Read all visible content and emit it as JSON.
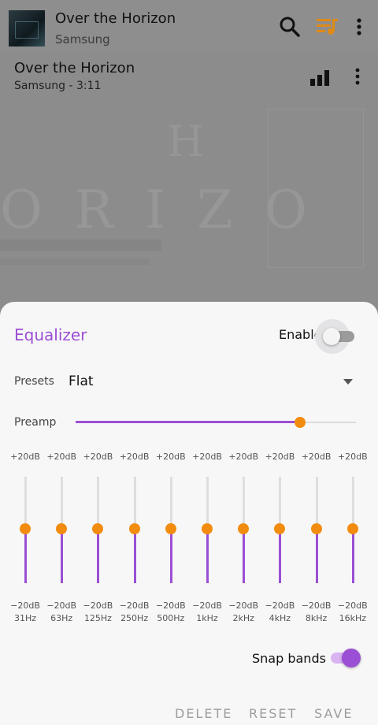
{
  "mini_player": {
    "title": "Over the Horizon",
    "artist": "Samsung"
  },
  "now_playing": {
    "title": "Over the Horizon",
    "subtitle": "Samsung  -  3:11",
    "art_letters": "ORIZO",
    "art_h": "H"
  },
  "icons": {
    "search": "search-icon",
    "queue": "queue-music-icon",
    "more": "more-vertical-icon",
    "equalizer_bars": "equalizer-bars-icon",
    "dropdown": "chevron-down-icon"
  },
  "equalizer": {
    "title": "Equalizer",
    "enable_label": "Enable",
    "enabled": false,
    "presets_label": "Presets",
    "preset_value": "Flat",
    "preamp_label": "Preamp",
    "preamp_level": 0.8,
    "bands": [
      {
        "freq": "31Hz",
        "max": "+20dB",
        "min": "−20dB",
        "gain_db": 0
      },
      {
        "freq": "63Hz",
        "max": "+20dB",
        "min": "−20dB",
        "gain_db": 0
      },
      {
        "freq": "125Hz",
        "max": "+20dB",
        "min": "−20dB",
        "gain_db": 0
      },
      {
        "freq": "250Hz",
        "max": "+20dB",
        "min": "−20dB",
        "gain_db": 0
      },
      {
        "freq": "500Hz",
        "max": "+20dB",
        "min": "−20dB",
        "gain_db": 0
      },
      {
        "freq": "1kHz",
        "max": "+20dB",
        "min": "−20dB",
        "gain_db": 0
      },
      {
        "freq": "2kHz",
        "max": "+20dB",
        "min": "−20dB",
        "gain_db": 0
      },
      {
        "freq": "4kHz",
        "max": "+20dB",
        "min": "−20dB",
        "gain_db": 0
      },
      {
        "freq": "8kHz",
        "max": "+20dB",
        "min": "−20dB",
        "gain_db": 0
      },
      {
        "freq": "16kHz",
        "max": "+20dB",
        "min": "−20dB",
        "gain_db": 0
      }
    ],
    "snap_label": "Snap bands",
    "snap_enabled": true,
    "actions": {
      "delete": "DELETE",
      "reset": "RESET",
      "save": "SAVE"
    }
  },
  "colors": {
    "accent": "#9b4fd4",
    "thumb": "#f28c0f",
    "queue_icon": "#e08a16"
  }
}
